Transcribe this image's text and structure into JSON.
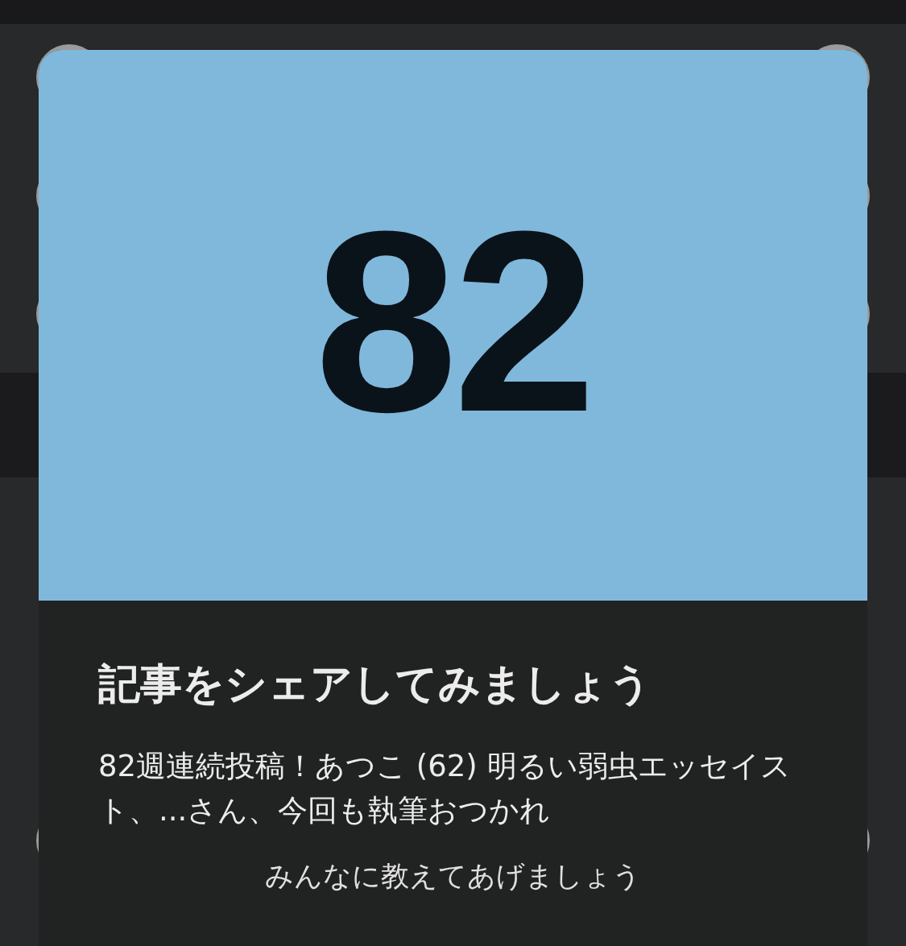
{
  "share_card": {
    "count": "82",
    "title": "記事をシェアしてみましょう",
    "message": "82週連続投稿！あつこ (62) 明るい弱虫エッセイスト、...さん、今回も執筆おつかれ",
    "hint": "みんなに教えてあげましょう"
  }
}
